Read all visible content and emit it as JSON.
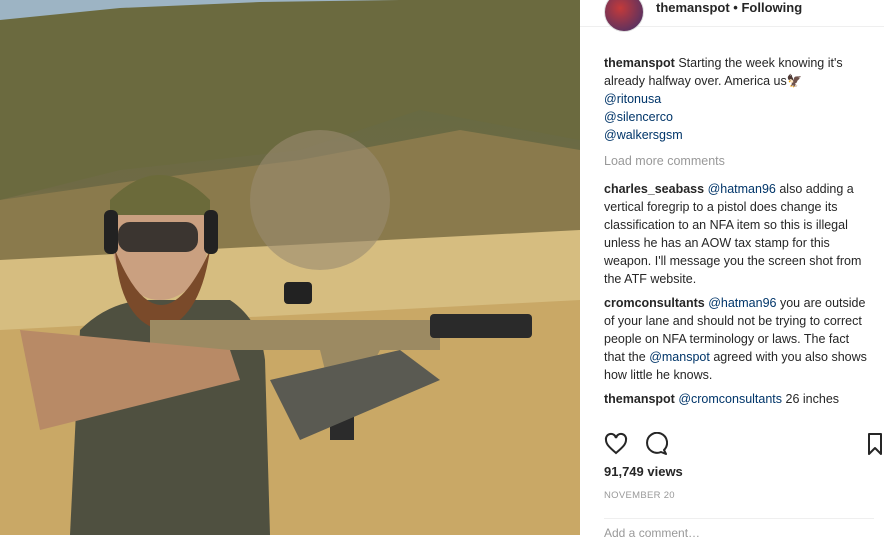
{
  "header": {
    "username": "themanspot",
    "separator": "•",
    "follow_label": "Following"
  },
  "caption": {
    "username": "themanspot",
    "text": "Starting the week knowing it's already halfway over. America us",
    "emoji": "🦅",
    "mentions": [
      "@ritonusa",
      "@silencerco",
      "@walkersgsm"
    ]
  },
  "load_more": "Load more comments",
  "comments": [
    {
      "username": "charles_seabass",
      "mention": "@hatman96",
      "text": "also adding a vertical foregrip to a pistol does change its classification to an NFA item so this is illegal unless he has an AOW tax stamp for this weapon. I'll message you the screen shot from the ATF website."
    },
    {
      "username": "cromconsultants",
      "mention": "@hatman96",
      "text": "you are outside of your lane and should not be trying to correct people on NFA terminology or laws. The fact that the",
      "mention2": "@manspot",
      "text2": "agreed with you also shows how little he knows."
    },
    {
      "username": "themanspot",
      "mention": "@cromconsultants",
      "text": "26 inches"
    }
  ],
  "stats": {
    "views": "91,749 views",
    "date": "NOVEMBER 20"
  },
  "add_comment": "Add a comment…",
  "icons": {
    "like": "heart-icon",
    "comment": "comment-icon",
    "save": "bookmark-icon"
  }
}
